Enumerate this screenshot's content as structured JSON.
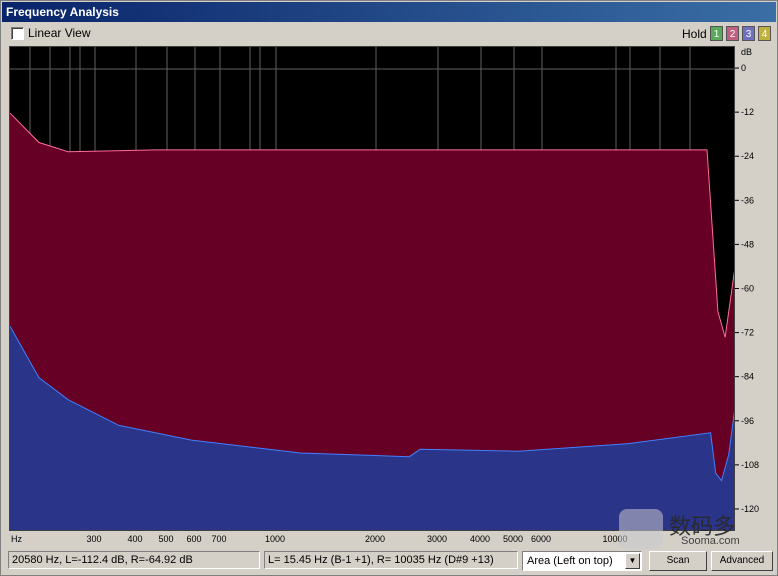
{
  "window": {
    "title": "Frequency Analysis"
  },
  "toolbar": {
    "linear_view_label": "Linear View",
    "hold_label": "Hold",
    "hold_buttons": [
      {
        "label": "1",
        "color": "#5aa85a"
      },
      {
        "label": "2",
        "color": "#c06080"
      },
      {
        "label": "3",
        "color": "#7070c0"
      },
      {
        "label": "4",
        "color": "#c0b040"
      }
    ]
  },
  "colors": {
    "plot_bg": "#000000",
    "left_fill": "#660025",
    "left_line": "#ff6aa0",
    "right_fill": "#2a3488",
    "right_line": "#4080ff",
    "grid": "#606060"
  },
  "axis": {
    "y_unit": "dB",
    "y_ticks": [
      "0",
      "-12",
      "-24",
      "-36",
      "-48",
      "-60",
      "-72",
      "-84",
      "-96",
      "-108",
      "-120"
    ],
    "x_unit": "Hz",
    "x_ticks": [
      "300",
      "400",
      "500",
      "600",
      "700",
      "1000",
      "2000",
      "3000",
      "4000",
      "5000",
      "6000",
      "10000"
    ]
  },
  "chart_data": {
    "type": "area",
    "ylabel": "dB",
    "xlabel": "Hz",
    "ylim": [
      -126,
      6
    ],
    "series": [
      {
        "x": [
          0,
          0.04,
          0.08,
          0.2,
          0.5,
          0.8,
          0.96,
          0.975,
          0.985,
          1.0
        ],
        "y": [
          -12,
          -20,
          -22.5,
          -22,
          -22,
          -22,
          -22,
          -66,
          -73,
          -52
        ]
      },
      {
        "x": [
          0,
          0.04,
          0.08,
          0.15,
          0.25,
          0.4,
          0.55,
          0.565,
          0.7,
          0.85,
          0.965,
          0.972,
          0.98,
          0.99,
          1.0
        ],
        "y": [
          -70,
          -84,
          -90,
          -97,
          -101,
          -104.5,
          -105.5,
          -103.5,
          -104,
          -102,
          -99,
          -110,
          -112,
          -105,
          -90
        ]
      }
    ]
  },
  "status": {
    "cursor_readout": "20580 Hz, L=-112.4 dB, R=-64.92 dB",
    "marker_readout": "L=  15.45 Hz (B-1 +1), R=  10035 Hz (D#9 +13)",
    "display_mode": "Area (Left on top)",
    "scan_label": "Scan",
    "advanced_label": "Advanced"
  },
  "watermark": {
    "text": "数码多",
    "url": "Sooma.com"
  }
}
